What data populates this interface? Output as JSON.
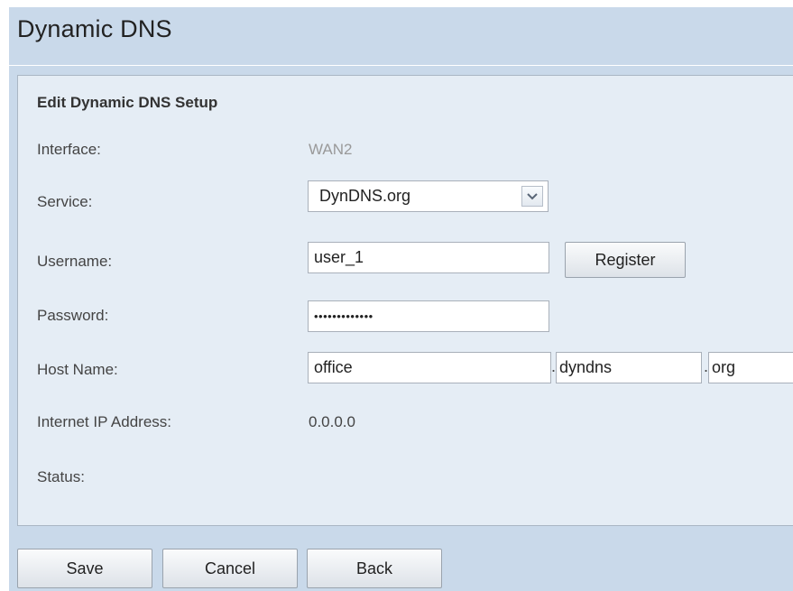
{
  "page": {
    "title": "Dynamic DNS"
  },
  "section": {
    "title": "Edit Dynamic DNS Setup"
  },
  "fields": {
    "interface": {
      "label": "Interface:",
      "value": "WAN2"
    },
    "service": {
      "label": "Service:",
      "value": "DynDNS.org",
      "icon": "chevron-down-icon"
    },
    "username": {
      "label": "Username:",
      "value": "user_1",
      "register_label": "Register"
    },
    "password": {
      "label": "Password:",
      "value": "•••••••••••••"
    },
    "host_name": {
      "label": "Host Name:",
      "host": "office",
      "domain": "dyndns",
      "tld": "org",
      "separator": "."
    },
    "internet_ip": {
      "label": "Internet IP Address:",
      "value": "0.0.0.0"
    },
    "status": {
      "label": "Status:",
      "value": ""
    }
  },
  "footer": {
    "save_label": "Save",
    "cancel_label": "Cancel",
    "back_label": "Back"
  },
  "colors": {
    "page_background": "#c9d9ea",
    "panel_background": "#e5edf5",
    "muted_text": "#999999"
  }
}
